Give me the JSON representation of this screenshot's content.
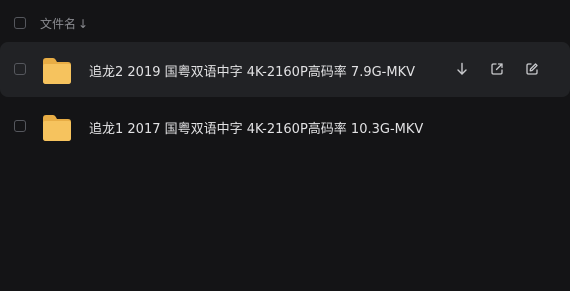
{
  "header": {
    "column_label": "文件名",
    "sort_arrow": "↓"
  },
  "files": [
    {
      "name": "追龙2 2019 国粤双语中字 4K-2160P高码率 7.9G-MKV",
      "icon": "folder-icon",
      "hovered": true,
      "actions": [
        "download-icon",
        "share-icon",
        "edit-icon"
      ]
    },
    {
      "name": "追龙1 2017 国粤双语中字 4K-2160P高码率 10.3G-MKV",
      "icon": "folder-icon",
      "hovered": false,
      "actions": []
    }
  ],
  "colors": {
    "background": "#141416",
    "row_hover": "#212225",
    "folder": "#f6c35e",
    "text": "#e2e2e4",
    "muted": "#8a8b90"
  }
}
